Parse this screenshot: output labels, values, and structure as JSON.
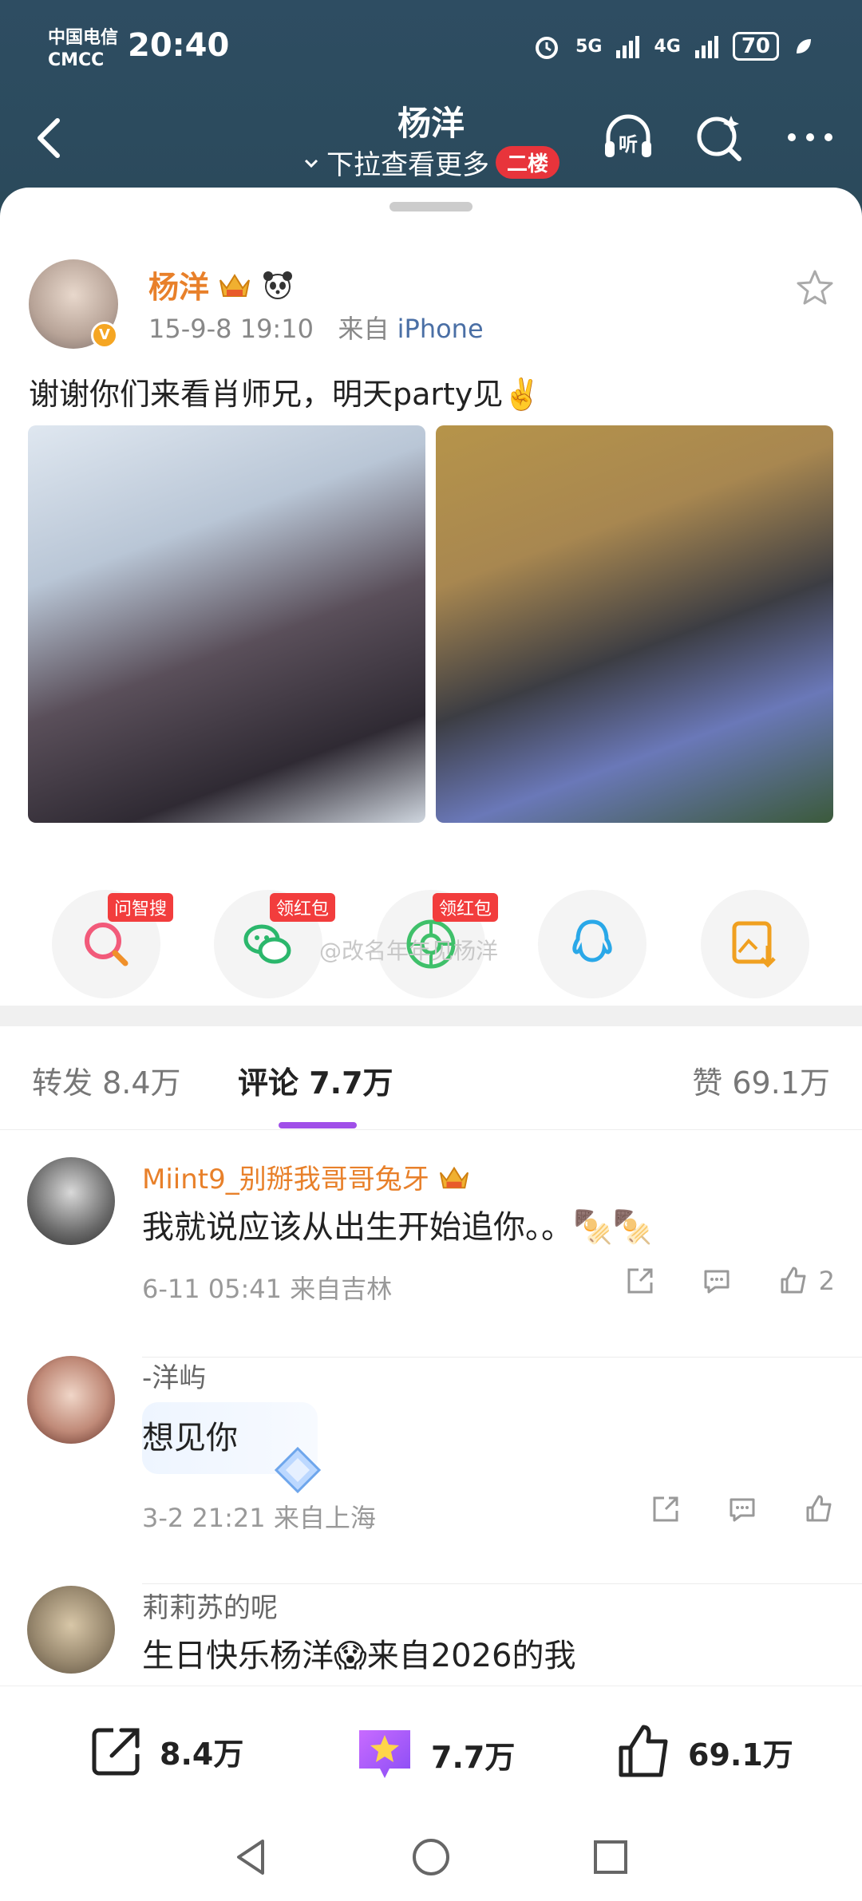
{
  "status": {
    "carrier_line1": "中国电信",
    "carrier_line2": "CMCC",
    "time": "20:40",
    "net1": "5G",
    "net2": "4G",
    "battery": "70"
  },
  "nav": {
    "title": "杨洋",
    "subtitle": "下拉查看更多",
    "floor_badge": "二楼",
    "listen_label": "听"
  },
  "post": {
    "author": "杨洋",
    "time": "15-9-8 19:10",
    "source_prefix": "来自",
    "source": "iPhone",
    "text": "谢谢你们来看肖师兄，明天party见✌️"
  },
  "share": {
    "items": [
      {
        "icon": "search-ai-icon",
        "tag": "问智搜"
      },
      {
        "icon": "wechat-icon",
        "tag": "领红包"
      },
      {
        "icon": "moments-icon",
        "tag": "领红包"
      },
      {
        "icon": "qq-icon",
        "tag": ""
      },
      {
        "icon": "save-image-icon",
        "tag": ""
      }
    ],
    "watermark": "@改名年年见杨洋"
  },
  "tabs": {
    "repost": "转发 8.4万",
    "comments": "评论 7.7万",
    "likes": "赞 69.1万"
  },
  "comments": [
    {
      "name": "Miint9_别掰我哥哥兔牙",
      "text": "我就说应该从出生开始追你。。",
      "emoji": "🍢🍢",
      "meta": "6-11 05:41 来自吉林",
      "likes": "2"
    },
    {
      "name": "-洋屿",
      "text": "想见你",
      "meta": "3-2 21:21 来自上海",
      "likes": ""
    },
    {
      "name": "莉莉苏的呢",
      "text": "生日快乐杨洋😱来自2026的我",
      "meta": "",
      "likes": ""
    }
  ],
  "bottom": {
    "reposts": "8.4万",
    "comments": "7.7万",
    "likes": "69.1万"
  },
  "colors": {
    "header_bg": "#2e4d62",
    "accent_orange": "#e8802a",
    "tab_underline": "#a04fe8",
    "badge_red": "#e8343b"
  }
}
